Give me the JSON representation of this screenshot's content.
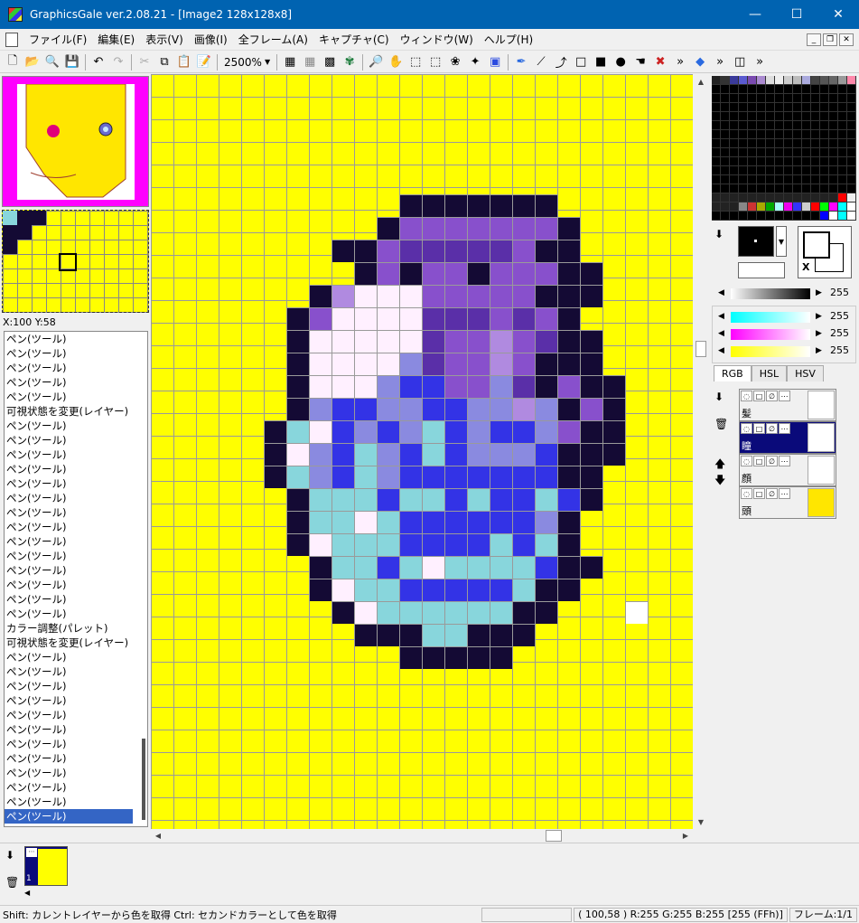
{
  "window": {
    "title": "GraphicsGale ver.2.08.21 - [Image2 128x128x8]",
    "min_icon": "minimize-icon",
    "max_icon": "maximize-icon",
    "close_icon": "close-icon"
  },
  "menu": [
    "ファイル(F)",
    "編集(E)",
    "表示(V)",
    "画像(I)",
    "全フレーム(A)",
    "キャプチャ(C)",
    "ウィンドウ(W)",
    "ヘルプ(H)"
  ],
  "toolbar": {
    "zoom": "2500%"
  },
  "nav": {
    "coord": "X:100 Y:58"
  },
  "history": [
    "ペン(ツール)",
    "ペン(ツール)",
    "ペン(ツール)",
    "ペン(ツール)",
    "ペン(ツール)",
    "可視状態を変更(レイヤー)",
    "ペン(ツール)",
    "ペン(ツール)",
    "ペン(ツール)",
    "ペン(ツール)",
    "ペン(ツール)",
    "ペン(ツール)",
    "ペン(ツール)",
    "ペン(ツール)",
    "ペン(ツール)",
    "ペン(ツール)",
    "ペン(ツール)",
    "ペン(ツール)",
    "ペン(ツール)",
    "ペン(ツール)",
    "カラー調整(パレット)",
    "可視状態を変更(レイヤー)",
    "ペン(ツール)",
    "ペン(ツール)",
    "ペン(ツール)",
    "ペン(ツール)",
    "ペン(ツール)",
    "ペン(ツール)",
    "ペン(ツール)",
    "ペン(ツール)",
    "ペン(ツール)",
    "ペン(ツール)",
    "ペン(ツール)",
    "ペン(ツール)"
  ],
  "color": {
    "gray_value": "255",
    "r_value": "255",
    "g_value": "255",
    "b_value": "255",
    "x_label": "X"
  },
  "tabs": [
    "RGB",
    "HSL",
    "HSV"
  ],
  "layers": [
    {
      "name": "髪"
    },
    {
      "name": "瞳"
    },
    {
      "name": "顔"
    },
    {
      "name": "頭"
    }
  ],
  "frames": {
    "num": "1"
  },
  "status": {
    "hint": "Shift: カレントレイヤーから色を取得  Ctrl: セカンドカラーとして色を取得",
    "pixel": "( 100,58 ) R:255 G:255 B:255  [255 (FFh)]",
    "frame": "フレーム:1/1"
  },
  "colors": {
    "canvas": "#ffff00",
    "outline": "#140a34",
    "purple": "#8850cc",
    "violet": "#5a2fa8",
    "blue": "#3333e6",
    "cyan": "#88d6dc",
    "white": "#fff0ff"
  }
}
